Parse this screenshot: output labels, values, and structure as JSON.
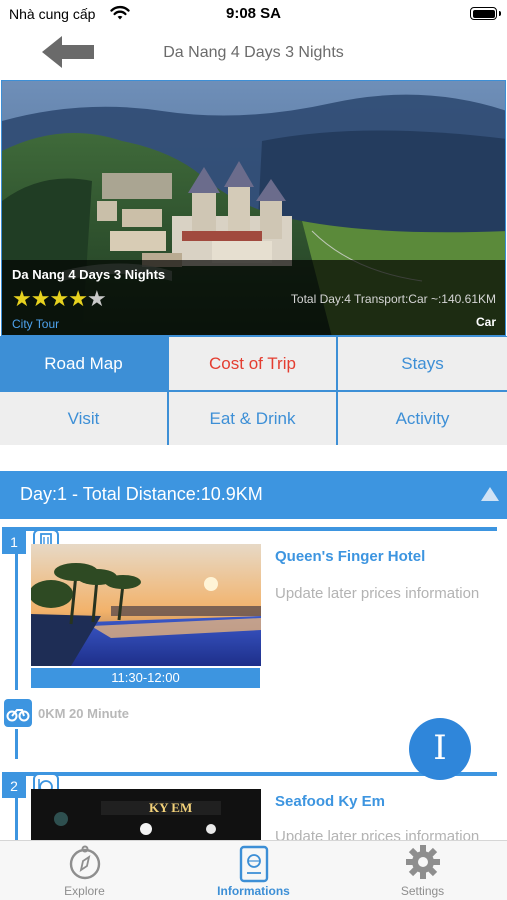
{
  "status_bar": {
    "carrier": "Nhà cung cấp",
    "time": "9:08 SA"
  },
  "nav": {
    "title": "Da Nang 4 Days 3 Nights",
    "back_icon": "arrow-left-icon"
  },
  "hero": {
    "title": "Da Nang 4 Days 3 Nights",
    "rating": 4,
    "rating_max": 5,
    "stats": "Total Day:4 Transport:Car  ~:140.61KM",
    "category": "City Tour",
    "transport": "Car"
  },
  "menu": [
    {
      "label": "Road Map",
      "state": "active"
    },
    {
      "label": "Cost of Trip",
      "state": "warn"
    },
    {
      "label": "Stays",
      "state": "normal"
    },
    {
      "label": "Visit",
      "state": "normal"
    },
    {
      "label": "Eat & Drink",
      "state": "normal"
    },
    {
      "label": "Activity",
      "state": "normal"
    }
  ],
  "day": {
    "label": "Day:1 - Total Distance:10.9KM",
    "toggle_icon": "triangle-up-icon"
  },
  "stops": [
    {
      "number": "1",
      "icon": "hotel-icon",
      "name": "Queen's Finger Hotel",
      "description": "Update later prices information",
      "time": "11:30-12:00"
    },
    {
      "number": "2",
      "icon": "restaurant-icon",
      "name": "Seafood Ky Em",
      "description": "Update later prices information",
      "sign": "KY EM"
    }
  ],
  "transit": {
    "icon": "motorbike-icon",
    "text": "0KM 20 Minute"
  },
  "fab": {
    "label": "I"
  },
  "tabbar": [
    {
      "label": "Explore",
      "icon": "compass-icon"
    },
    {
      "label": "Informations",
      "icon": "passport-icon"
    },
    {
      "label": "Settings",
      "icon": "gear-icon"
    }
  ],
  "colors": {
    "primary": "#3d8fd6",
    "warning": "#e43d30",
    "star": "#e7d21f"
  }
}
